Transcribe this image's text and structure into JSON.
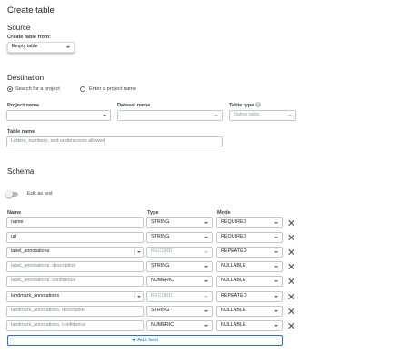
{
  "page": {
    "title": "Create table"
  },
  "source": {
    "heading": "Source",
    "create_from_label": "Create table from:",
    "create_from_value": "Empty table"
  },
  "destination": {
    "heading": "Destination",
    "radio_search": "Search for a project",
    "radio_enter": "Enter a project name",
    "project_label": "Project name",
    "project_value": "",
    "dataset_label": "Dataset name",
    "dataset_value": "",
    "table_type_label": "Table type",
    "table_type_value": "Native table",
    "table_name_label": "Table name",
    "table_name_placeholder": "Letters, numbers, and underscores allowed"
  },
  "schema": {
    "heading": "Schema",
    "edit_as_text_label": "Edit as text",
    "edit_as_text_on": false,
    "col_name": "Name",
    "col_type": "Type",
    "col_mode": "Mode",
    "rows": [
      {
        "name": "name",
        "type": "STRING",
        "mode": "REQUIRED",
        "sub": false,
        "expand": false
      },
      {
        "name": "url",
        "type": "STRING",
        "mode": "REQUIRED",
        "sub": false,
        "expand": false
      },
      {
        "name": "label_annotations",
        "type": "RECORD",
        "mode": "REPEATED",
        "sub": false,
        "expand": true
      },
      {
        "name": "label_annotations. description",
        "type": "STRING",
        "mode": "NULLABLE",
        "sub": true,
        "expand": false
      },
      {
        "name": "label_annotations. confidence",
        "type": "NUMERIC",
        "mode": "NULLABLE",
        "sub": true,
        "expand": false
      },
      {
        "name": "landmark_annotations",
        "type": "RECORD",
        "mode": "REPEATED",
        "sub": false,
        "expand": true
      },
      {
        "name": "landmark_annotations. description",
        "type": "STRING",
        "mode": "NULLABLE",
        "sub": true,
        "expand": false
      },
      {
        "name": "landmark_annotations. confidence",
        "type": "NUMERIC",
        "mode": "NULLABLE",
        "sub": true,
        "expand": false
      }
    ],
    "add_field_label": "Add field",
    "add_field_icon": "plus-icon",
    "delete_icon": "close-icon"
  }
}
